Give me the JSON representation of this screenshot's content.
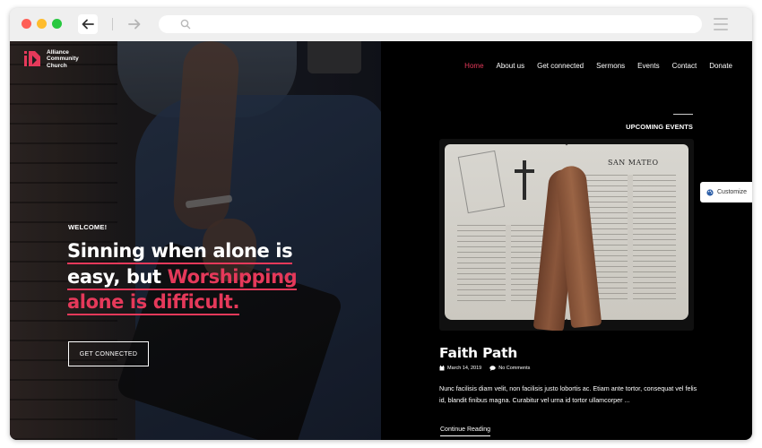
{
  "browser": {
    "icons": {
      "back": "arrow-left-icon",
      "forward": "arrow-right-icon",
      "search": "search-icon",
      "menu": "hamburger-icon"
    },
    "url": ""
  },
  "site": {
    "logo_lines": [
      "Alliance",
      "Community",
      "Church"
    ],
    "brand_color": "#e5395a"
  },
  "nav": {
    "items": [
      {
        "label": "Home",
        "active": true
      },
      {
        "label": "About us",
        "active": false
      },
      {
        "label": "Get connected",
        "active": false
      },
      {
        "label": "Sermons",
        "active": false
      },
      {
        "label": "Events",
        "active": false
      },
      {
        "label": "Contact",
        "active": false
      },
      {
        "label": "Donate",
        "active": false
      }
    ]
  },
  "hero": {
    "eyebrow": "WELCOME!",
    "headline": {
      "line1": "Sinning when alone is",
      "line2_plain": "easy, but ",
      "line2_accent": "Worshipping",
      "line3_accent": "alone is difficult."
    },
    "cta_label": "GET CONNECTED"
  },
  "events": {
    "section_title": "UPCOMING EVENTS",
    "featured": {
      "image_text": "SAN MATEO",
      "title": "Faith Path",
      "date": "March 14, 2019",
      "comments": "No Comments",
      "excerpt": "Nunc facilisis diam velit, non facilisis justo lobortis ac. Etiam ante tortor, consequat vel felis id, blandit finibus magna. Curabitur vel urna id tortor ullamcorper ...",
      "read_more": "Continue Reading"
    }
  },
  "customize": {
    "label": "Customize",
    "icon": "palette-icon"
  }
}
